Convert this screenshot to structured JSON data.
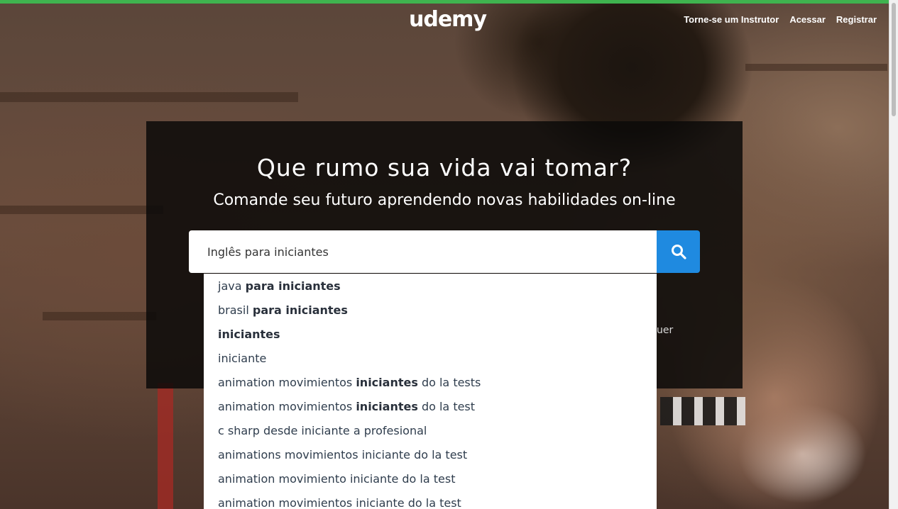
{
  "header": {
    "logo": "udemy",
    "nav": {
      "instructor": "Torne-se um Instrutor",
      "login": "Acessar",
      "signup": "Registrar"
    }
  },
  "hero": {
    "headline": "Que rumo sua vida vai tomar?",
    "subheadline": "Comande seu futuro aprendendo novas habilidades on-line",
    "peek_text": "uer"
  },
  "search": {
    "value": "Inglês para iniciantes",
    "button_icon": "search-icon"
  },
  "suggestions": [
    {
      "parts": [
        {
          "t": "java ",
          "b": false
        },
        {
          "t": "para iniciantes",
          "b": true
        }
      ]
    },
    {
      "parts": [
        {
          "t": "brasil ",
          "b": false
        },
        {
          "t": "para iniciantes",
          "b": true
        }
      ]
    },
    {
      "parts": [
        {
          "t": "iniciantes",
          "b": true
        }
      ]
    },
    {
      "parts": [
        {
          "t": "iniciante",
          "b": false
        }
      ]
    },
    {
      "parts": [
        {
          "t": "animation movimientos ",
          "b": false
        },
        {
          "t": "iniciantes",
          "b": true
        },
        {
          "t": " do la tests",
          "b": false
        }
      ]
    },
    {
      "parts": [
        {
          "t": "animation movimientos ",
          "b": false
        },
        {
          "t": "iniciantes",
          "b": true
        },
        {
          "t": " do la test",
          "b": false
        }
      ]
    },
    {
      "parts": [
        {
          "t": "c sharp desde iniciante a profesional",
          "b": false
        }
      ]
    },
    {
      "parts": [
        {
          "t": "animations movimientos iniciante do la test",
          "b": false
        }
      ]
    },
    {
      "parts": [
        {
          "t": "animation movimiento iniciante do la test",
          "b": false
        }
      ]
    },
    {
      "parts": [
        {
          "t": "animation movimientos iniciante do la test",
          "b": false
        }
      ]
    }
  ],
  "colors": {
    "accent_green": "#3fb34f",
    "search_button": "#1f8ae0",
    "text_dark": "#2f3d4d"
  }
}
